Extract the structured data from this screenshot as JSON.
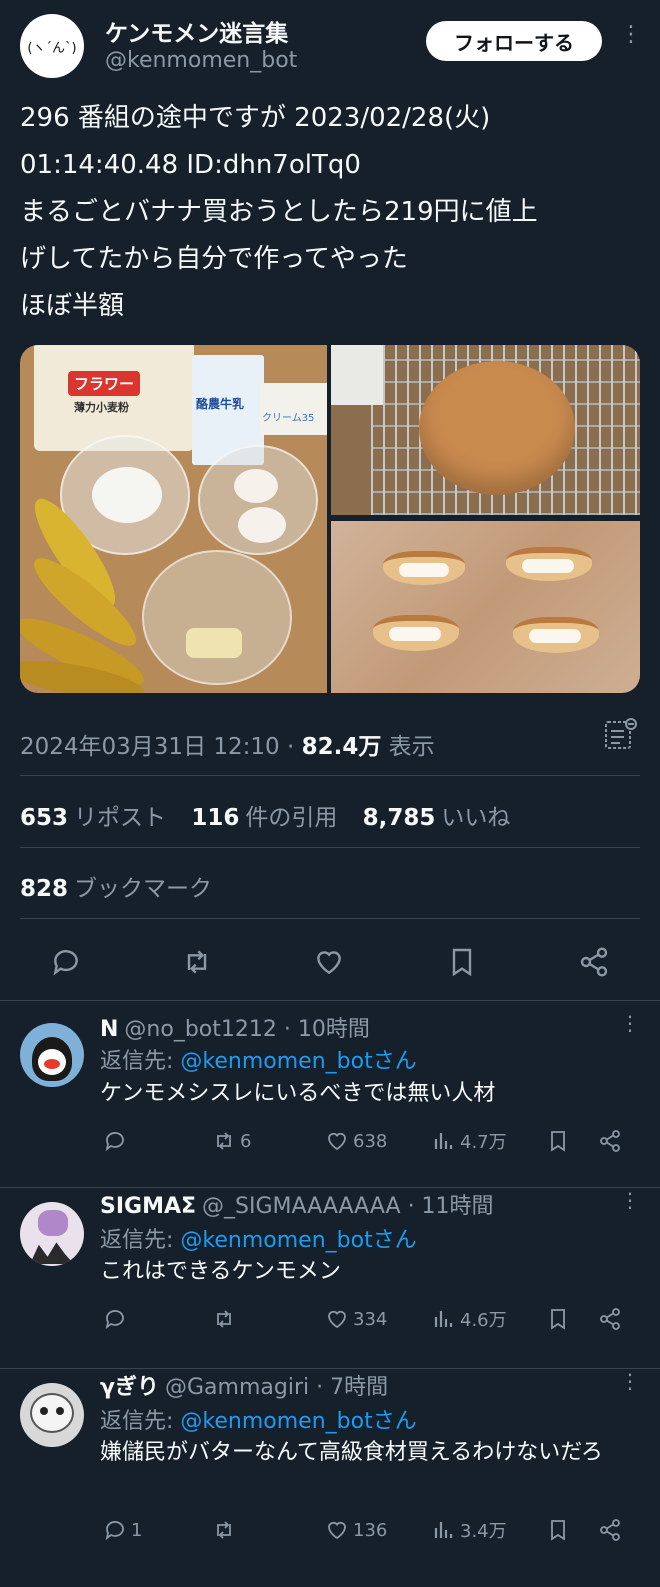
{
  "author": {
    "avatar_text": "(ヽ´ん`)",
    "name": "ケンモメン迷言集",
    "handle": "@kenmomen_bot",
    "follow_label": "フォローする"
  },
  "tweet": {
    "lines": [
      "296 番組の途中ですが 2023/02/28(火)",
      "01:14:40.48 ID:dhn7olTq0",
      "まるごとバナナ買おうとしたら219円に値上",
      "げしてたから自分で作ってやった",
      "ほぼ半額"
    ],
    "media": {
      "flour_label": "フラワー",
      "flour_sub": "薄力小麦粉",
      "milk_label": "酪農牛乳",
      "cream_label": "クリーム35"
    },
    "timestamp": "2024年03月31日 12:10",
    "separator": "·",
    "views": "82.4万",
    "views_label": "表示"
  },
  "stats": {
    "reposts": "653",
    "reposts_label": "リポスト",
    "quotes": "116",
    "quotes_label": "件の引用",
    "likes": "8,785",
    "likes_label": "いいね",
    "bookmarks": "828",
    "bookmarks_label": "ブックマーク"
  },
  "replies": [
    {
      "name": "N",
      "handle": "@no_bot1212",
      "time": "· 10時間",
      "reply_prefix": "返信先: ",
      "reply_to": "@kenmomen_botさん",
      "text": "ケンモメシスレにいるべきでは無い人材",
      "reply_count": "",
      "repost_count": "6",
      "like_count": "638",
      "view_count": "4.7万"
    },
    {
      "name": "SIGMAΣ",
      "handle": "@_SIGMAAAAAAA",
      "time": "· 11時間",
      "reply_prefix": "返信先: ",
      "reply_to": "@kenmomen_botさん",
      "text": "これはできるケンモメン",
      "reply_count": "",
      "repost_count": "",
      "like_count": "334",
      "view_count": "4.6万"
    },
    {
      "name": "γぎり",
      "handle": "@Gammagiri",
      "time": "· 7時間",
      "reply_prefix": "返信先: ",
      "reply_to": "@kenmomen_botさん",
      "text": "嫌儲民がバターなんて高級食材買えるわけないだろ",
      "reply_count": "1",
      "repost_count": "",
      "like_count": "136",
      "view_count": "3.4万"
    }
  ],
  "colors": {
    "background": "#15202b",
    "text": "#f7f9f9",
    "muted": "#8b98a5",
    "link": "#1d9bf0",
    "divider": "#38444d"
  }
}
